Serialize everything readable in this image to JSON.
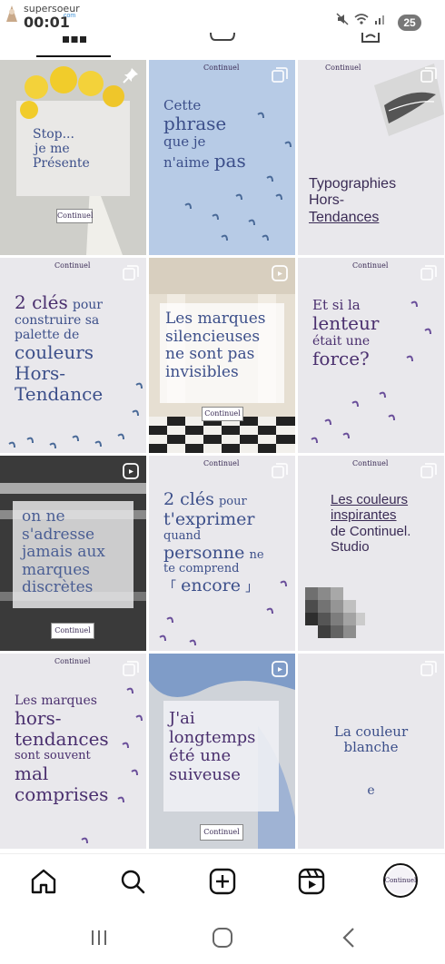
{
  "status_bar": {
    "app_name": "supersoeur",
    "app_sub": "com",
    "time": "00:01",
    "battery": "25"
  },
  "tabs": [
    {
      "label": "posts-grid",
      "icon": "grid-icon",
      "active": true
    },
    {
      "label": "reels",
      "icon": "reels-icon",
      "active": false
    },
    {
      "label": "tagged",
      "icon": "tagged-icon",
      "active": false
    }
  ],
  "watermark": "Continuel",
  "posts": [
    {
      "lines": [
        "Stop...",
        "je me",
        "Présente"
      ],
      "badge": "pin-icon"
    },
    {
      "lines": [
        "Cette",
        "phrase",
        "que je",
        "n'aime",
        "pas"
      ],
      "badge": "carousel-icon"
    },
    {
      "lines": [
        "Typographies",
        "Hors-",
        "Tendances"
      ],
      "badge": "carousel-icon"
    },
    {
      "lines": [
        "2 clés",
        "pour",
        "construire sa",
        "palette de",
        "couleurs",
        "Hors-",
        "Tendance"
      ],
      "badge": "carousel-icon"
    },
    {
      "lines": [
        "Les marques",
        "silencieuses",
        "ne sont pas",
        "invisibles"
      ],
      "badge": "reel-icon"
    },
    {
      "lines": [
        "Et si la",
        "lenteur",
        "était une",
        "force?"
      ],
      "badge": "carousel-icon"
    },
    {
      "lines": [
        "on ne",
        "s'adresse",
        "jamais aux",
        "marques",
        "discrètes"
      ],
      "badge": "reel-icon"
    },
    {
      "lines": [
        "2 clés",
        "pour",
        "t'exprimer",
        "quand",
        "personne",
        "ne",
        "te comprend",
        "「",
        "encore",
        "」"
      ],
      "badge": "carousel-icon"
    },
    {
      "lines": [
        "Les couleurs",
        "inspirantes",
        "de Continuel.",
        "Studio"
      ],
      "badge": "carousel-icon"
    },
    {
      "lines": [
        "Les marques",
        "hors-",
        "tendances",
        "sont souvent",
        "mal",
        "comprises"
      ],
      "badge": "carousel-icon"
    },
    {
      "lines": [
        "J'ai",
        "longtemps",
        "été une",
        "suiveuse"
      ],
      "badge": "reel-icon"
    },
    {
      "lines": [
        "La couleur",
        "blanche",
        "e"
      ],
      "badge": "carousel-icon"
    }
  ],
  "bottom_nav": [
    {
      "icon": "home-icon"
    },
    {
      "icon": "search-icon"
    },
    {
      "icon": "create-icon"
    },
    {
      "icon": "reels-icon"
    },
    {
      "icon": "profile-avatar"
    }
  ],
  "colors": {
    "purple": "#4a2f6e",
    "blue": "#3c4f8a",
    "tile_light": "#e9e8ec",
    "tile_blue": "#b7cbe6"
  }
}
